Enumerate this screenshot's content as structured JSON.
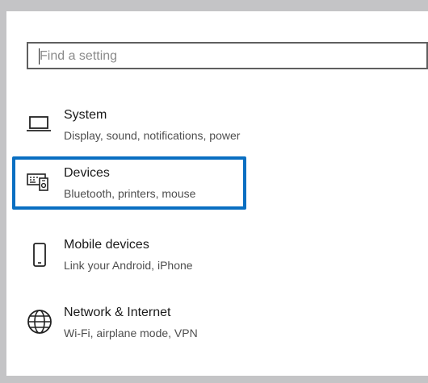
{
  "search": {
    "placeholder": "Find a setting",
    "value": ""
  },
  "settings": {
    "items": [
      {
        "title": "System",
        "description": "Display, sound, notifications, power",
        "icon": "laptop-icon",
        "selected": false
      },
      {
        "title": "Devices",
        "description": "Bluetooth, printers, mouse",
        "icon": "devices-icon",
        "selected": true
      },
      {
        "title": "Mobile devices",
        "description": "Link your Android, iPhone",
        "icon": "phone-icon",
        "selected": false
      },
      {
        "title": "Network & Internet",
        "description": "Wi-Fi, airplane mode, VPN",
        "icon": "globe-icon",
        "selected": false
      }
    ]
  },
  "colors": {
    "selection_border": "#0a6fc2",
    "window_frame": "#c4c4c6"
  }
}
